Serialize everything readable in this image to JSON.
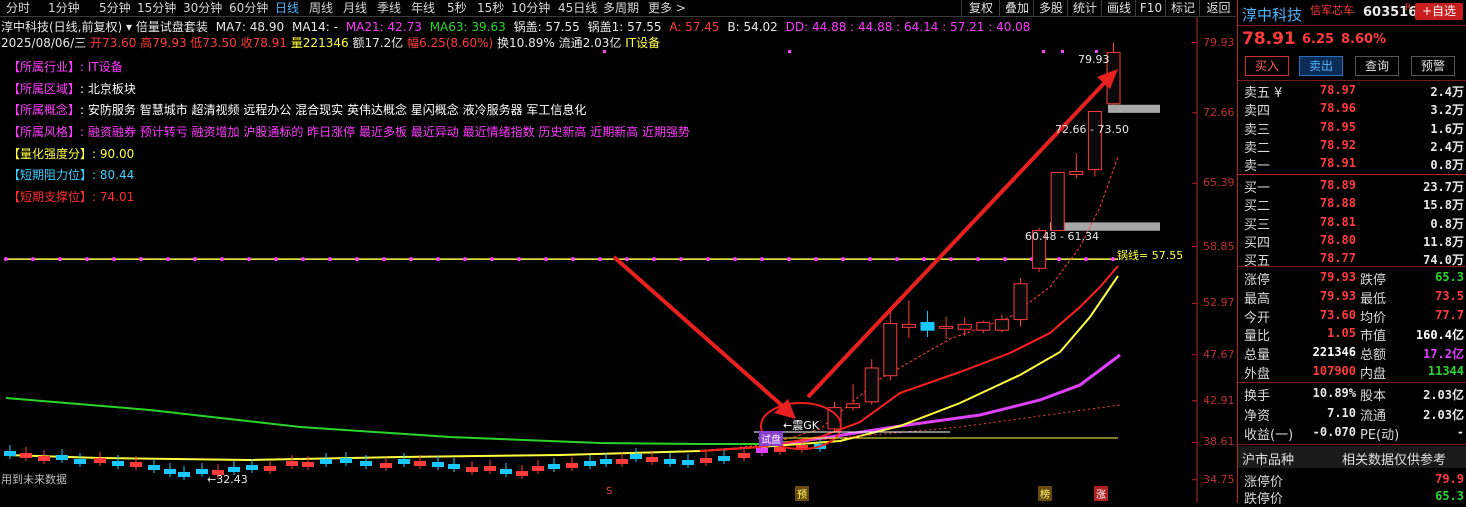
{
  "toolbar": {
    "periods": [
      "分时",
      "1分钟",
      "5分钟",
      "15分钟",
      "30分钟",
      "60分钟",
      "日线",
      "周线",
      "月线",
      "季线",
      "年线",
      "5秒",
      "15秒",
      "10分钟",
      "45日线",
      "多周期",
      "更多 >"
    ],
    "active_period": "日线",
    "tools": [
      "复权",
      "叠加",
      "多股",
      "统计",
      "画线",
      "F10",
      "标记",
      "返回"
    ]
  },
  "header": {
    "stock_title": "淳中科技(日线,前复权)",
    "indicator_name": "倍量试盘套装",
    "ma7": "MA7: 48.90",
    "ma14": "MA14: -",
    "ma21": "MA21: 42.73",
    "ma63": "MA63: 39.63",
    "guogai": "锅盖: 57.55",
    "guogai1": "锅盖1: 57.55",
    "a": "A: 57.45",
    "b": "B: 54.02",
    "dd": "DD: 44.88 : 44.88 : 64.14 : 57.21 : 40.08",
    "date": "2025/08/06/三",
    "open": "开73.60",
    "high": "高79.93",
    "low": "低73.50",
    "close": "收78.91",
    "volume": "量221346",
    "amount": "额17.2亿",
    "change": "幅6.25(8.60%)",
    "turnover": "换10.89%",
    "float_cap": "流通2.03亿",
    "industry_tag": "IT设备"
  },
  "info_panel": [
    {
      "label": "【所属行业】",
      "value": ": IT设备",
      "label_color": "#ff3aff",
      "value_color": "#ff3aff"
    },
    {
      "label": "【所属区域】",
      "value": ": 北京板块",
      "label_color": "#ff3aff",
      "value_color": "#ffffff"
    },
    {
      "label": "【所属概念】",
      "value": ": 安防服务 智慧城市 超清视频 远程办公 混合现实 英伟达概念 星闪概念 液冷服务器 军工信息化",
      "label_color": "#ff3aff",
      "value_color": "#ffffff"
    },
    {
      "label": "【所属风格】",
      "value": ": 融资融券 预计转亏 融资增加 沪股通标的 昨日涨停 最近多板 最近异动 最近情绪指数 历史新高 近期新高 近期强势",
      "label_color": "#ff3aff",
      "value_color": "#ff3aff"
    },
    {
      "label": "【量化强度分】",
      "value": ": 90.00",
      "label_color": "#ffff40",
      "value_color": "#ffff40"
    },
    {
      "label": "【短期阻力位】",
      "value": ": 80.44",
      "label_color": "#3ad0ff",
      "value_color": "#3ad0ff"
    },
    {
      "label": "【短期支撑位】",
      "value": ": 74.01",
      "label_color": "#ff3030",
      "value_color": "#ff3030"
    }
  ],
  "y_axis": {
    "ticks": [
      "79.93",
      "72.66",
      "65.39",
      "58.85",
      "52.97",
      "47.67",
      "42.91",
      "38.61",
      "34.75"
    ]
  },
  "chart_data": {
    "type": "candlestick",
    "y_range": [
      34.0,
      80.5
    ],
    "candles_recent": [
      {
        "o": 40.0,
        "h": 42.8,
        "l": 39.6,
        "c": 42.2
      },
      {
        "o": 42.2,
        "h": 44.6,
        "l": 41.9,
        "c": 42.6
      },
      {
        "o": 42.8,
        "h": 47.2,
        "l": 42.5,
        "c": 46.3
      },
      {
        "o": 45.5,
        "h": 52.5,
        "l": 45.0,
        "c": 50.9
      },
      {
        "o": 50.5,
        "h": 53.3,
        "l": 49.4,
        "c": 50.8
      },
      {
        "o": 51.0,
        "h": 52.2,
        "l": 49.5,
        "c": 50.2
      },
      {
        "o": 50.4,
        "h": 51.6,
        "l": 49.3,
        "c": 50.6
      },
      {
        "o": 50.3,
        "h": 51.5,
        "l": 49.6,
        "c": 50.8
      },
      {
        "o": 50.2,
        "h": 51.2,
        "l": 49.9,
        "c": 51.0
      },
      {
        "o": 50.2,
        "h": 51.8,
        "l": 50.0,
        "c": 51.3
      },
      {
        "o": 51.3,
        "h": 55.6,
        "l": 50.6,
        "c": 55.0
      },
      {
        "o": 56.6,
        "h": 60.8,
        "l": 56.2,
        "c": 60.5
      },
      {
        "o": 60.5,
        "h": 66.5,
        "l": 60.5,
        "c": 66.5
      },
      {
        "o": 66.3,
        "h": 68.5,
        "l": 65.9,
        "c": 66.6
      },
      {
        "o": 66.8,
        "h": 72.8,
        "l": 66.1,
        "c": 72.8
      },
      {
        "o": 73.6,
        "h": 79.93,
        "l": 73.5,
        "c": 78.91
      }
    ],
    "high_label": "79.93",
    "low_label": "32.43",
    "guogai_line": 57.55,
    "guogai_label": "锅线= 57.55",
    "zones": [
      {
        "label": "72.66 - 73.50",
        "low": 72.66,
        "high": 73.5
      },
      {
        "label": "60.48 - 61.34",
        "low": 60.48,
        "high": 61.34
      }
    ],
    "annotations": {
      "quake": "震GK",
      "test": "试盘",
      "future": "用到未来数据",
      "markers": [
        "S",
        "预",
        "榜",
        "涨"
      ]
    }
  },
  "side": {
    "name": "淳中科技",
    "tag": "信军芯车",
    "code": "603516",
    "rzr_badge": "R",
    "self_select": "+自选",
    "price": "78.91",
    "change": "6.25",
    "change_pct": "8.60%",
    "buttons": [
      "买入",
      "卖出",
      "查询",
      "预警"
    ],
    "asks": [
      {
        "label": "卖五 ¥",
        "price": "78.97",
        "vol": "2.4万"
      },
      {
        "label": "卖四",
        "price": "78.96",
        "vol": "3.2万"
      },
      {
        "label": "卖三",
        "price": "78.95",
        "vol": "1.6万"
      },
      {
        "label": "卖二",
        "price": "78.92",
        "vol": "2.4万"
      },
      {
        "label": "卖一",
        "price": "78.91",
        "vol": "0.8万"
      }
    ],
    "bids": [
      {
        "label": "买一",
        "price": "78.89",
        "vol": "23.7万"
      },
      {
        "label": "买二",
        "price": "78.88",
        "vol": "15.8万"
      },
      {
        "label": "买三",
        "price": "78.81",
        "vol": "0.8万"
      },
      {
        "label": "买四",
        "price": "78.80",
        "vol": "11.8万"
      },
      {
        "label": "买五",
        "price": "78.77",
        "vol": "74.0万"
      }
    ],
    "stats": [
      {
        "l1": "涨停",
        "v1": "79.93",
        "c1": "#ff3b3b",
        "l2": "跌停",
        "v2": "65.3",
        "c2": "#2ad42a"
      },
      {
        "l1": "最高",
        "v1": "79.93",
        "c1": "#ff3b3b",
        "l2": "最低",
        "v2": "73.5",
        "c2": "#ff3b3b"
      },
      {
        "l1": "今开",
        "v1": "73.60",
        "c1": "#ff3b3b",
        "l2": "均价",
        "v2": "77.7",
        "c2": "#ff3b3b"
      },
      {
        "l1": "量比",
        "v1": "1.05",
        "c1": "#ff3b3b",
        "l2": "市值",
        "v2": "160.4亿",
        "c2": "#ffffff"
      },
      {
        "l1": "总量",
        "v1": "221346",
        "c1": "#ffffff",
        "l2": "总额",
        "v2": "17.2亿",
        "c2": "#e040ff"
      },
      {
        "l1": "外盘",
        "v1": "107900",
        "c1": "#ff3b3b",
        "l2": "内盘",
        "v2": "11344",
        "c2": "#2ad42a"
      }
    ],
    "stats2": [
      {
        "l1": "换手",
        "v1": "10.89%",
        "l2": "股本",
        "v2": "2.03亿"
      },
      {
        "l1": "净资",
        "v1": "7.10",
        "l2": "流通",
        "v2": "2.03亿"
      },
      {
        "l1": "收益(一)",
        "v1": "-0.070",
        "l2": "PE(动)",
        "v2": "-"
      }
    ],
    "market": {
      "left": "沪市品种",
      "right": "相关数据仅供参考"
    },
    "limit_rows": [
      {
        "label": "涨停价",
        "value": "79.9"
      },
      {
        "label": "跌停价",
        "value": "65.3"
      }
    ]
  }
}
